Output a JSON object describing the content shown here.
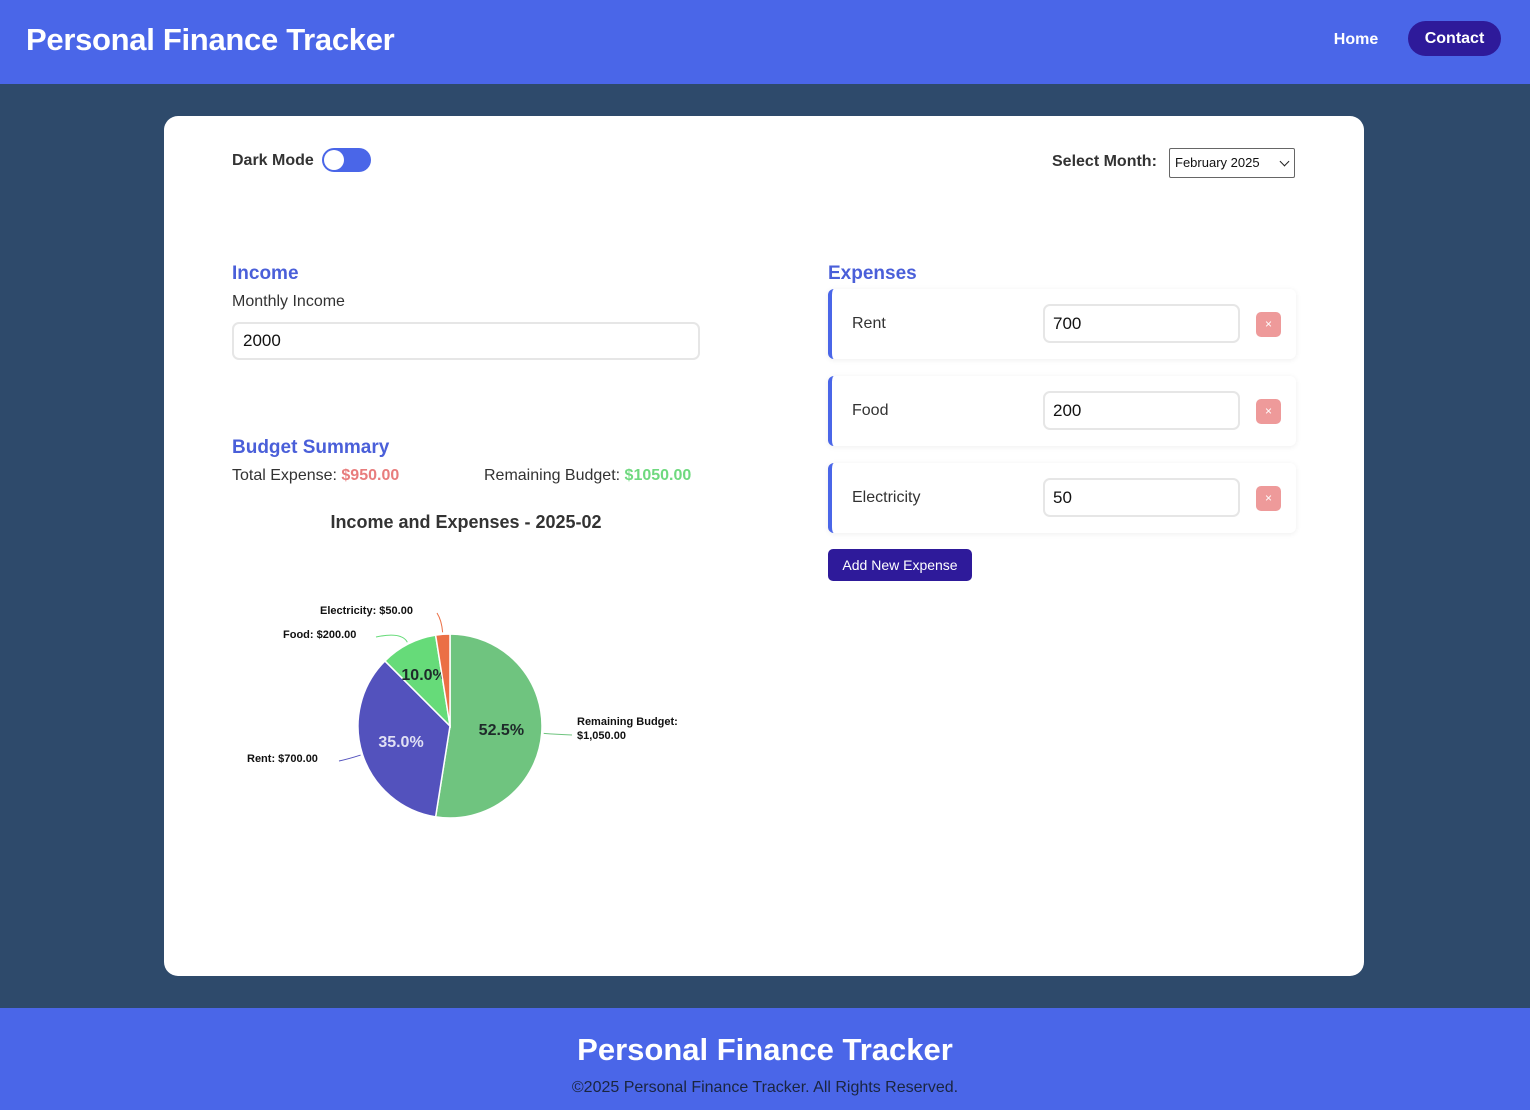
{
  "header": {
    "title": "Personal Finance Tracker",
    "nav": {
      "home": "Home",
      "contact": "Contact"
    }
  },
  "settings": {
    "dark_mode_label": "Dark Mode",
    "dark_mode_on": false,
    "month_label": "Select Month:",
    "month_value": "February 2025"
  },
  "income": {
    "title": "Income",
    "label": "Monthly Income",
    "value": "2000"
  },
  "summary": {
    "title": "Budget Summary",
    "total_label": "Total Expense:",
    "total_value": "$950.00",
    "remaining_label": "Remaining Budget:",
    "remaining_value": "$1050.00"
  },
  "expenses": {
    "title": "Expenses",
    "items": [
      {
        "name": "Rent",
        "amount": "700"
      },
      {
        "name": "Food",
        "amount": "200"
      },
      {
        "name": "Electricity",
        "amount": "50"
      }
    ],
    "delete_symbol": "×",
    "add_label": "Add New Expense"
  },
  "chart_data": {
    "type": "pie",
    "title": "Income and Expenses - 2025-02",
    "slices": [
      {
        "label": "Remaining Budget: $1,050.00",
        "value": 1050,
        "percent": "52.5%",
        "color": "#6fc47f"
      },
      {
        "label": "Rent: $700.00",
        "value": 700,
        "percent": "35.0%",
        "color": "#5352bd"
      },
      {
        "label": "Food: $200.00",
        "value": 200,
        "percent": "10.0%",
        "color": "#66db79"
      },
      {
        "label": "Electricity: $50.00",
        "value": 50,
        "percent": "",
        "color": "#eb6f45"
      }
    ]
  },
  "footer": {
    "title": "Personal Finance Tracker",
    "copyright": "©2025 Personal Finance Tracker. All Rights Reserved."
  }
}
